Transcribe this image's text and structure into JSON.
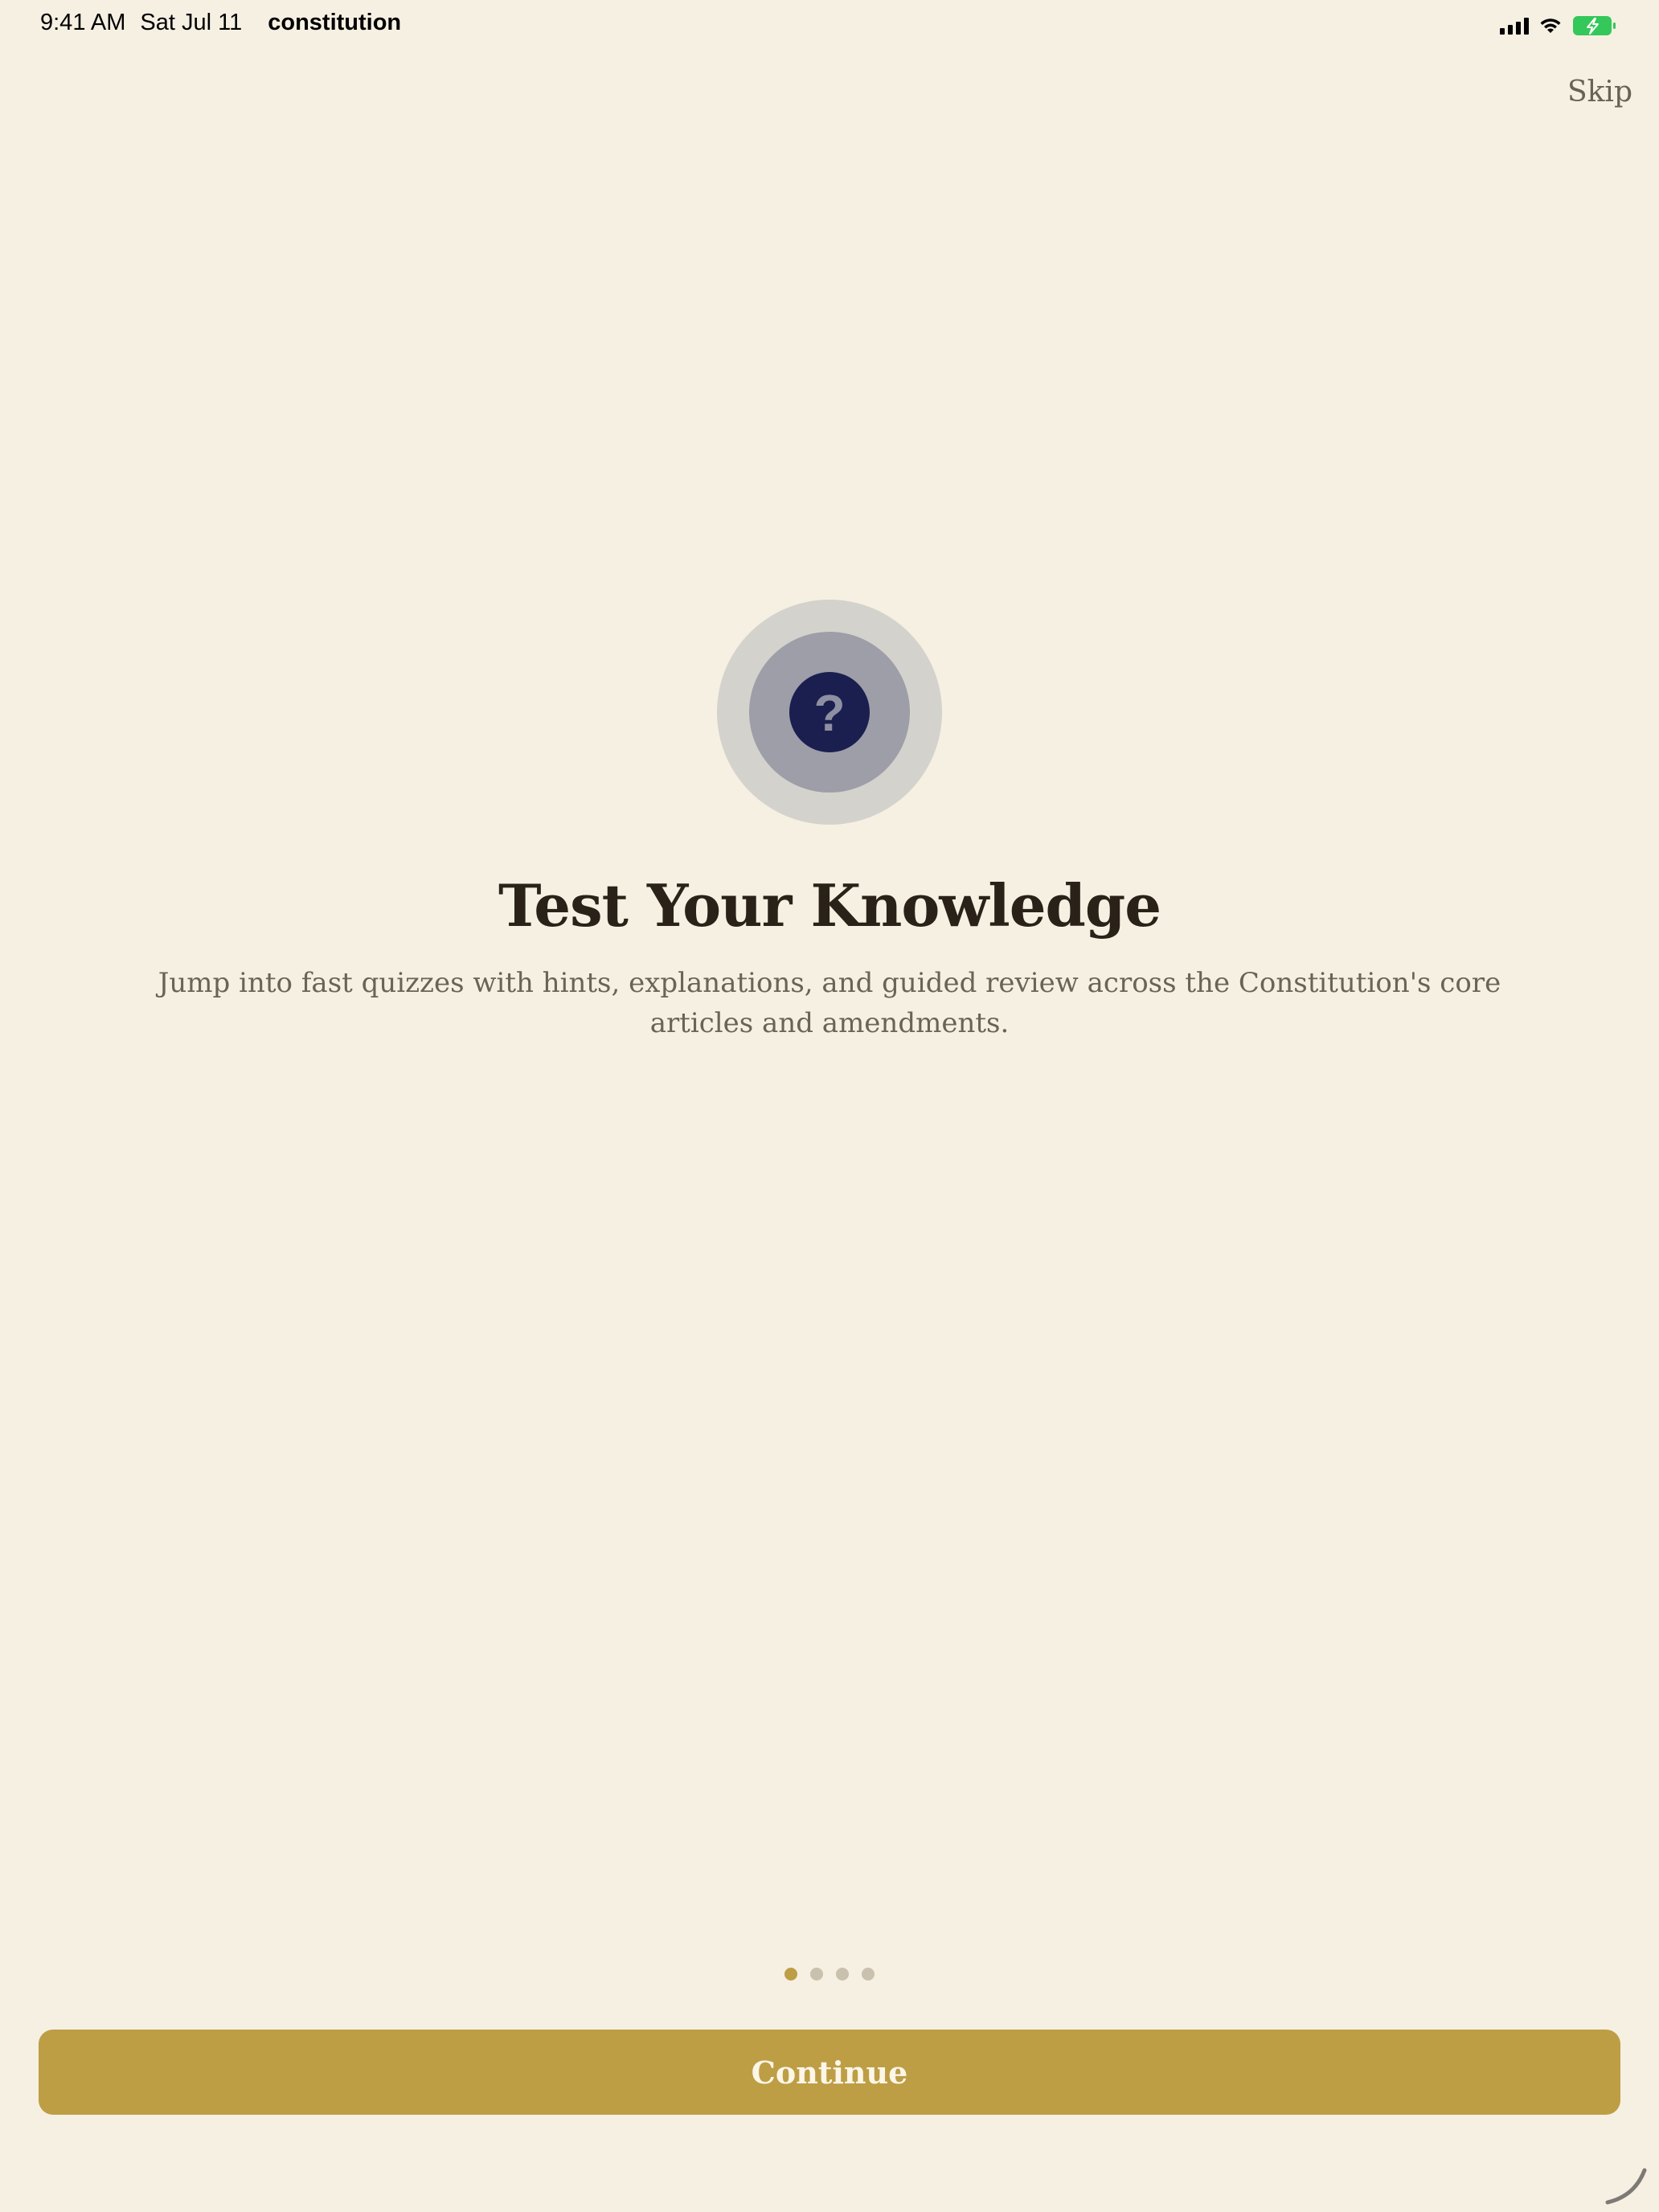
{
  "status_bar": {
    "time": "9:41 AM",
    "date": "Sat Jul 11",
    "app_name": "constitution",
    "icons": [
      "cellular-signal-icon",
      "wifi-icon",
      "battery-charging-icon"
    ],
    "battery_color": "#34c759"
  },
  "header": {
    "skip_label": "Skip"
  },
  "onboarding": {
    "icon": "question-mark-icon",
    "title": "Test Your Knowledge",
    "description": "Jump into fast quizzes with hints, explanations, and guided review across the Constitution's core articles and amendments.",
    "page_count": 4,
    "current_page": 1
  },
  "footer": {
    "continue_label": "Continue"
  },
  "colors": {
    "background": "#f6f0e3",
    "accent": "#bd9e45",
    "title": "#2a2218",
    "body_text": "#6b6355",
    "icon_core": "#1b1f4f",
    "dot_inactive": "#c9c1ad"
  }
}
